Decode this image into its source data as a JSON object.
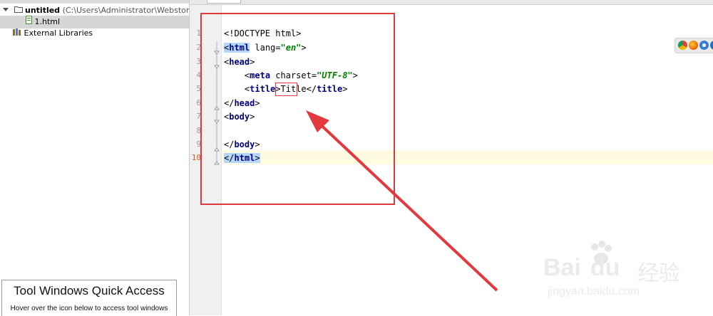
{
  "project": {
    "root_name": "untitled",
    "root_path": "(C:\\Users\\Administrator\\WebstormProject",
    "file_name": "1.html",
    "external_libraries": "External Libraries"
  },
  "quick_access": {
    "title": "Tool Windows Quick Access",
    "subtitle": "Hover over the icon below to access tool windows"
  },
  "editor": {
    "line_numbers": [
      "1",
      "2",
      "3",
      "4",
      "5",
      "6",
      "7",
      "8",
      "9",
      "10"
    ],
    "lines": [
      {
        "t1": "<!DOCTYPE html>"
      },
      {
        "open": "<",
        "tag": "html",
        "a": " lang=",
        "v": "\"en\"",
        "close": ">"
      },
      {
        "open": "<",
        "tag": "head",
        "close": ">"
      },
      {
        "indent": "    ",
        "open": "<",
        "tag": "meta",
        "a": " charset=",
        "v": "\"UTF-8\"",
        "close": ">"
      },
      {
        "indent": "    ",
        "open": "<",
        "tag": "title",
        "close": ">",
        "text": "Title",
        "open2": "</",
        "tag2": "title",
        "close2": ">"
      },
      {
        "open": "</",
        "tag": "head",
        "close": ">"
      },
      {
        "open": "<",
        "tag": "body",
        "close": ">"
      },
      {
        "t1": ""
      },
      {
        "open": "</",
        "tag": "body",
        "close": ">"
      },
      {
        "open": "</",
        "tag": "html",
        "close": ">"
      }
    ],
    "active_line": "10"
  },
  "colors": {
    "annotation_red": "#e3383e",
    "tag_blue": "#000080",
    "string_green": "#008000",
    "tag_highlight": "#b4d7ff"
  },
  "watermark": {
    "brand": "Bai",
    "brand2": "du",
    "cn": "经验",
    "url": "jingyan.baidu.com"
  }
}
